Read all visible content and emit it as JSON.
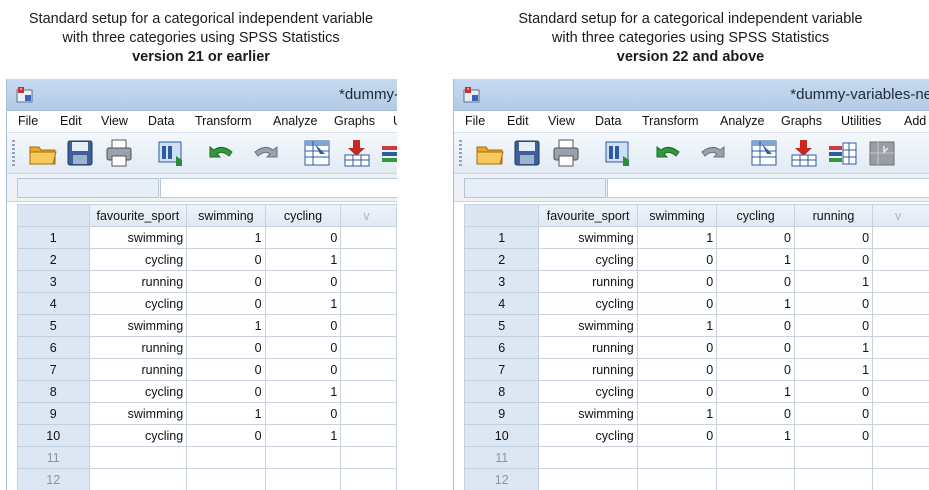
{
  "panels": [
    {
      "caption_line1": "Standard setup for a categorical independent variable",
      "caption_line2": "with three categories using SPSS Statistics",
      "caption_bold": "version 21 or earlier",
      "window_title": "*dummy-",
      "menu": [
        "File",
        "Edit",
        "View",
        "Data",
        "Transform",
        "Analyze",
        "Graphs",
        "U"
      ],
      "toolbar_icons": [
        "open-folder-icon",
        "save-icon",
        "print-icon",
        "dialog-recall-icon",
        "undo-icon",
        "redo-icon",
        "goto-case-icon",
        "goto-variable-icon",
        "variables-icon"
      ],
      "columns": [
        "favourite_sport",
        "swimming",
        "cycling",
        "v"
      ],
      "rows": [
        {
          "n": "1",
          "cells": [
            "swimming",
            "1",
            "0"
          ]
        },
        {
          "n": "2",
          "cells": [
            "cycling",
            "0",
            "1"
          ]
        },
        {
          "n": "3",
          "cells": [
            "running",
            "0",
            "0"
          ]
        },
        {
          "n": "4",
          "cells": [
            "cycling",
            "0",
            "1"
          ]
        },
        {
          "n": "5",
          "cells": [
            "swimming",
            "1",
            "0"
          ]
        },
        {
          "n": "6",
          "cells": [
            "running",
            "0",
            "0"
          ]
        },
        {
          "n": "7",
          "cells": [
            "running",
            "0",
            "0"
          ]
        },
        {
          "n": "8",
          "cells": [
            "cycling",
            "0",
            "1"
          ]
        },
        {
          "n": "9",
          "cells": [
            "swimming",
            "1",
            "0"
          ]
        },
        {
          "n": "10",
          "cells": [
            "cycling",
            "0",
            "1"
          ]
        },
        {
          "n": "11",
          "cells": [
            "",
            "",
            ""
          ]
        },
        {
          "n": "12",
          "cells": [
            "",
            "",
            ""
          ]
        }
      ]
    },
    {
      "caption_line1": "Standard setup for a categorical independent variable",
      "caption_line2": "with three categories using SPSS Statistics",
      "caption_bold": "version 22 and above",
      "window_title": "*dummy-variables-ne",
      "menu": [
        "File",
        "Edit",
        "View",
        "Data",
        "Transform",
        "Analyze",
        "Graphs",
        "Utilities",
        "Add"
      ],
      "toolbar_icons": [
        "open-folder-icon",
        "save-icon",
        "print-icon",
        "dialog-recall-icon",
        "undo-icon",
        "redo-icon",
        "goto-case-icon",
        "goto-variable-icon",
        "variables-icon",
        "run-descriptives-icon"
      ],
      "columns": [
        "favourite_sport",
        "swimming",
        "cycling",
        "running",
        "v"
      ],
      "rows": [
        {
          "n": "1",
          "cells": [
            "swimming",
            "1",
            "0",
            "0"
          ]
        },
        {
          "n": "2",
          "cells": [
            "cycling",
            "0",
            "1",
            "0"
          ]
        },
        {
          "n": "3",
          "cells": [
            "running",
            "0",
            "0",
            "1"
          ]
        },
        {
          "n": "4",
          "cells": [
            "cycling",
            "0",
            "1",
            "0"
          ]
        },
        {
          "n": "5",
          "cells": [
            "swimming",
            "1",
            "0",
            "0"
          ]
        },
        {
          "n": "6",
          "cells": [
            "running",
            "0",
            "0",
            "1"
          ]
        },
        {
          "n": "7",
          "cells": [
            "running",
            "0",
            "0",
            "1"
          ]
        },
        {
          "n": "8",
          "cells": [
            "cycling",
            "0",
            "1",
            "0"
          ]
        },
        {
          "n": "9",
          "cells": [
            "swimming",
            "1",
            "0",
            "0"
          ]
        },
        {
          "n": "10",
          "cells": [
            "cycling",
            "0",
            "1",
            "0"
          ]
        },
        {
          "n": "11",
          "cells": [
            "",
            "",
            "",
            ""
          ]
        },
        {
          "n": "12",
          "cells": [
            "",
            "",
            "",
            ""
          ]
        }
      ]
    }
  ]
}
